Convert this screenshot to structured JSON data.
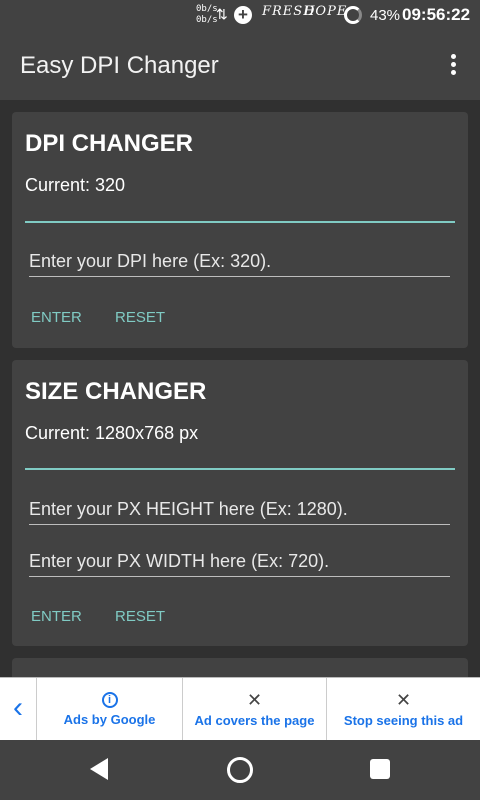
{
  "status": {
    "speed_up": "0b/s",
    "speed_down": "0b/s",
    "data_arrows": "⇅",
    "plus": "+",
    "graffiti_1": "FRESH",
    "graffiti_2": "DOPE",
    "battery": "43%",
    "time": "09:56:22"
  },
  "appbar": {
    "title": "Easy DPI Changer"
  },
  "dpi_card": {
    "title": "DPI CHANGER",
    "current": "Current: 320",
    "input_placeholder": "Enter your DPI here (Ex: 320).",
    "input_value": "",
    "enter_label": "ENTER",
    "reset_label": "RESET"
  },
  "size_card": {
    "title": "SIZE CHANGER",
    "current": "Current: 1280x768 px",
    "height_placeholder": "Enter your PX HEIGHT here (Ex: 1280).",
    "height_value": "",
    "width_placeholder": "Enter your PX WIDTH here (Ex: 720).",
    "width_value": "",
    "enter_label": "ENTER",
    "reset_label": "RESET"
  },
  "ad": {
    "back_glyph": "‹",
    "ads_by_google": "Ads by Google",
    "covers_page": "Ad covers the page",
    "stop_seeing": "Stop seeing this ad",
    "close_glyph": "✕",
    "info_glyph": "i"
  },
  "colors": {
    "accent": "#80cbc4",
    "card_bg": "#424242",
    "page_bg": "#303030",
    "ad_link": "#1a73e8"
  }
}
